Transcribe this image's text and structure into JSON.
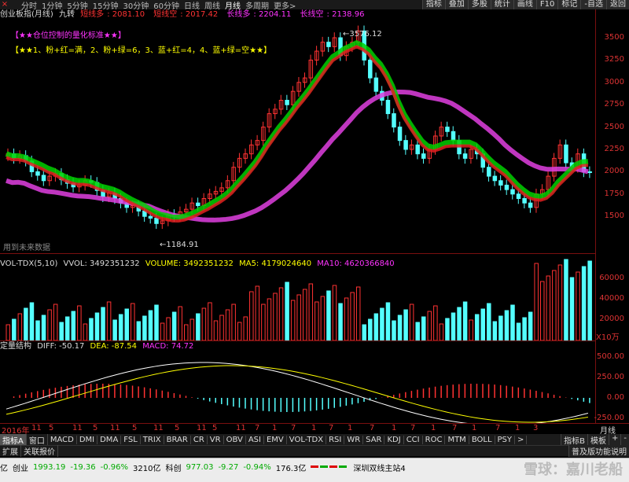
{
  "topbar": {
    "close": "×",
    "periods": [
      "分时",
      "1分钟",
      "5分钟",
      "15分钟",
      "30分钟",
      "60分钟",
      "日线",
      "周线",
      "月线",
      "多周期",
      "更多>"
    ],
    "active_period": "月线",
    "buttons": [
      "指标",
      "叠加",
      "多股",
      "统计",
      "画线",
      "F10",
      "标记",
      "-自选",
      "返回"
    ]
  },
  "main_panel": {
    "title": "创业板指(月线)",
    "indicator": "九转",
    "short_long_label": "短线多",
    "short_long_value": "2081.10",
    "short_short_label": "短线空",
    "short_short_value": "2017.42",
    "long_long_label": "长线多",
    "long_long_value": "2204.11",
    "long_short_label": "长线空",
    "long_short_value": "2138.96",
    "legend1": "【★★仓位控制的量化标准★★】",
    "legend2": "【★★1、粉+红=满，2、粉+绿=6，3、蓝+红=4，4、蓝+绿=空★★】",
    "high_label": "3576.12",
    "low_label": "1184.91",
    "future_note": "用到未来数据",
    "yticks": [
      "3500",
      "3250",
      "3000",
      "2750",
      "2500",
      "2250",
      "2000",
      "1750",
      "1500"
    ]
  },
  "vol_panel": {
    "title": "VOL-TDX(5,10)",
    "vvol": "VVOL: 3492351232",
    "volume": "VOLUME: 3492351232",
    "ma5": "MA5: 4179024640",
    "ma10": "MA10: 4620366840",
    "yticks": [
      "60000",
      "40000",
      "20000"
    ],
    "unit": "X10万"
  },
  "macd_panel": {
    "title": "定量结构",
    "diff": "DIFF: -50.17",
    "dea": "DEA: -87.54",
    "macd": "MACD: 74.72",
    "yticks": [
      "500.00",
      "250.00",
      "0.00",
      "-250.00"
    ]
  },
  "xaxis": {
    "labels": [
      "2016年",
      "11",
      "5",
      "11",
      "5",
      "11",
      "5",
      "11",
      "5",
      "11",
      "5",
      "11",
      "7",
      "1",
      "7",
      "1",
      "7",
      "1",
      "7",
      "1",
      "7",
      "1",
      "7",
      "1",
      "7",
      "1",
      "3"
    ],
    "right_label": "月线"
  },
  "indicators_bar": {
    "items": [
      "指标A",
      "窗口",
      "MACD",
      "DMI",
      "DMA",
      "FSL",
      "TRIX",
      "BRAR",
      "CR",
      "VR",
      "OBV",
      "ASI",
      "EMV",
      "VOL-TDX",
      "RSI",
      "WR",
      "SAR",
      "KDJ",
      "CCI",
      "ROC",
      "MTM",
      "BOLL",
      "PSY",
      ">"
    ],
    "active": "指标A",
    "right": [
      "指标B",
      "模板",
      "+",
      "-"
    ]
  },
  "second_bar": {
    "items": [
      "扩展",
      "关联报价"
    ],
    "right": "普及版功能说明"
  },
  "status": {
    "name": "创业",
    "price": "1993.19",
    "change": "-19.36",
    "pct": "-0.96%",
    "amount": "3210亿",
    "name2": "科创",
    "price2": "977.03",
    "change2": "-9.27",
    "pct2": "-0.94%",
    "amount2": "176.3亿",
    "station": "深圳双线主站4",
    "watermark": "雪球：嘉川老船",
    "prefix": "亿"
  },
  "colors": {
    "up": "#ff3232",
    "down": "#54ffff",
    "grid": "#7a1010"
  }
}
